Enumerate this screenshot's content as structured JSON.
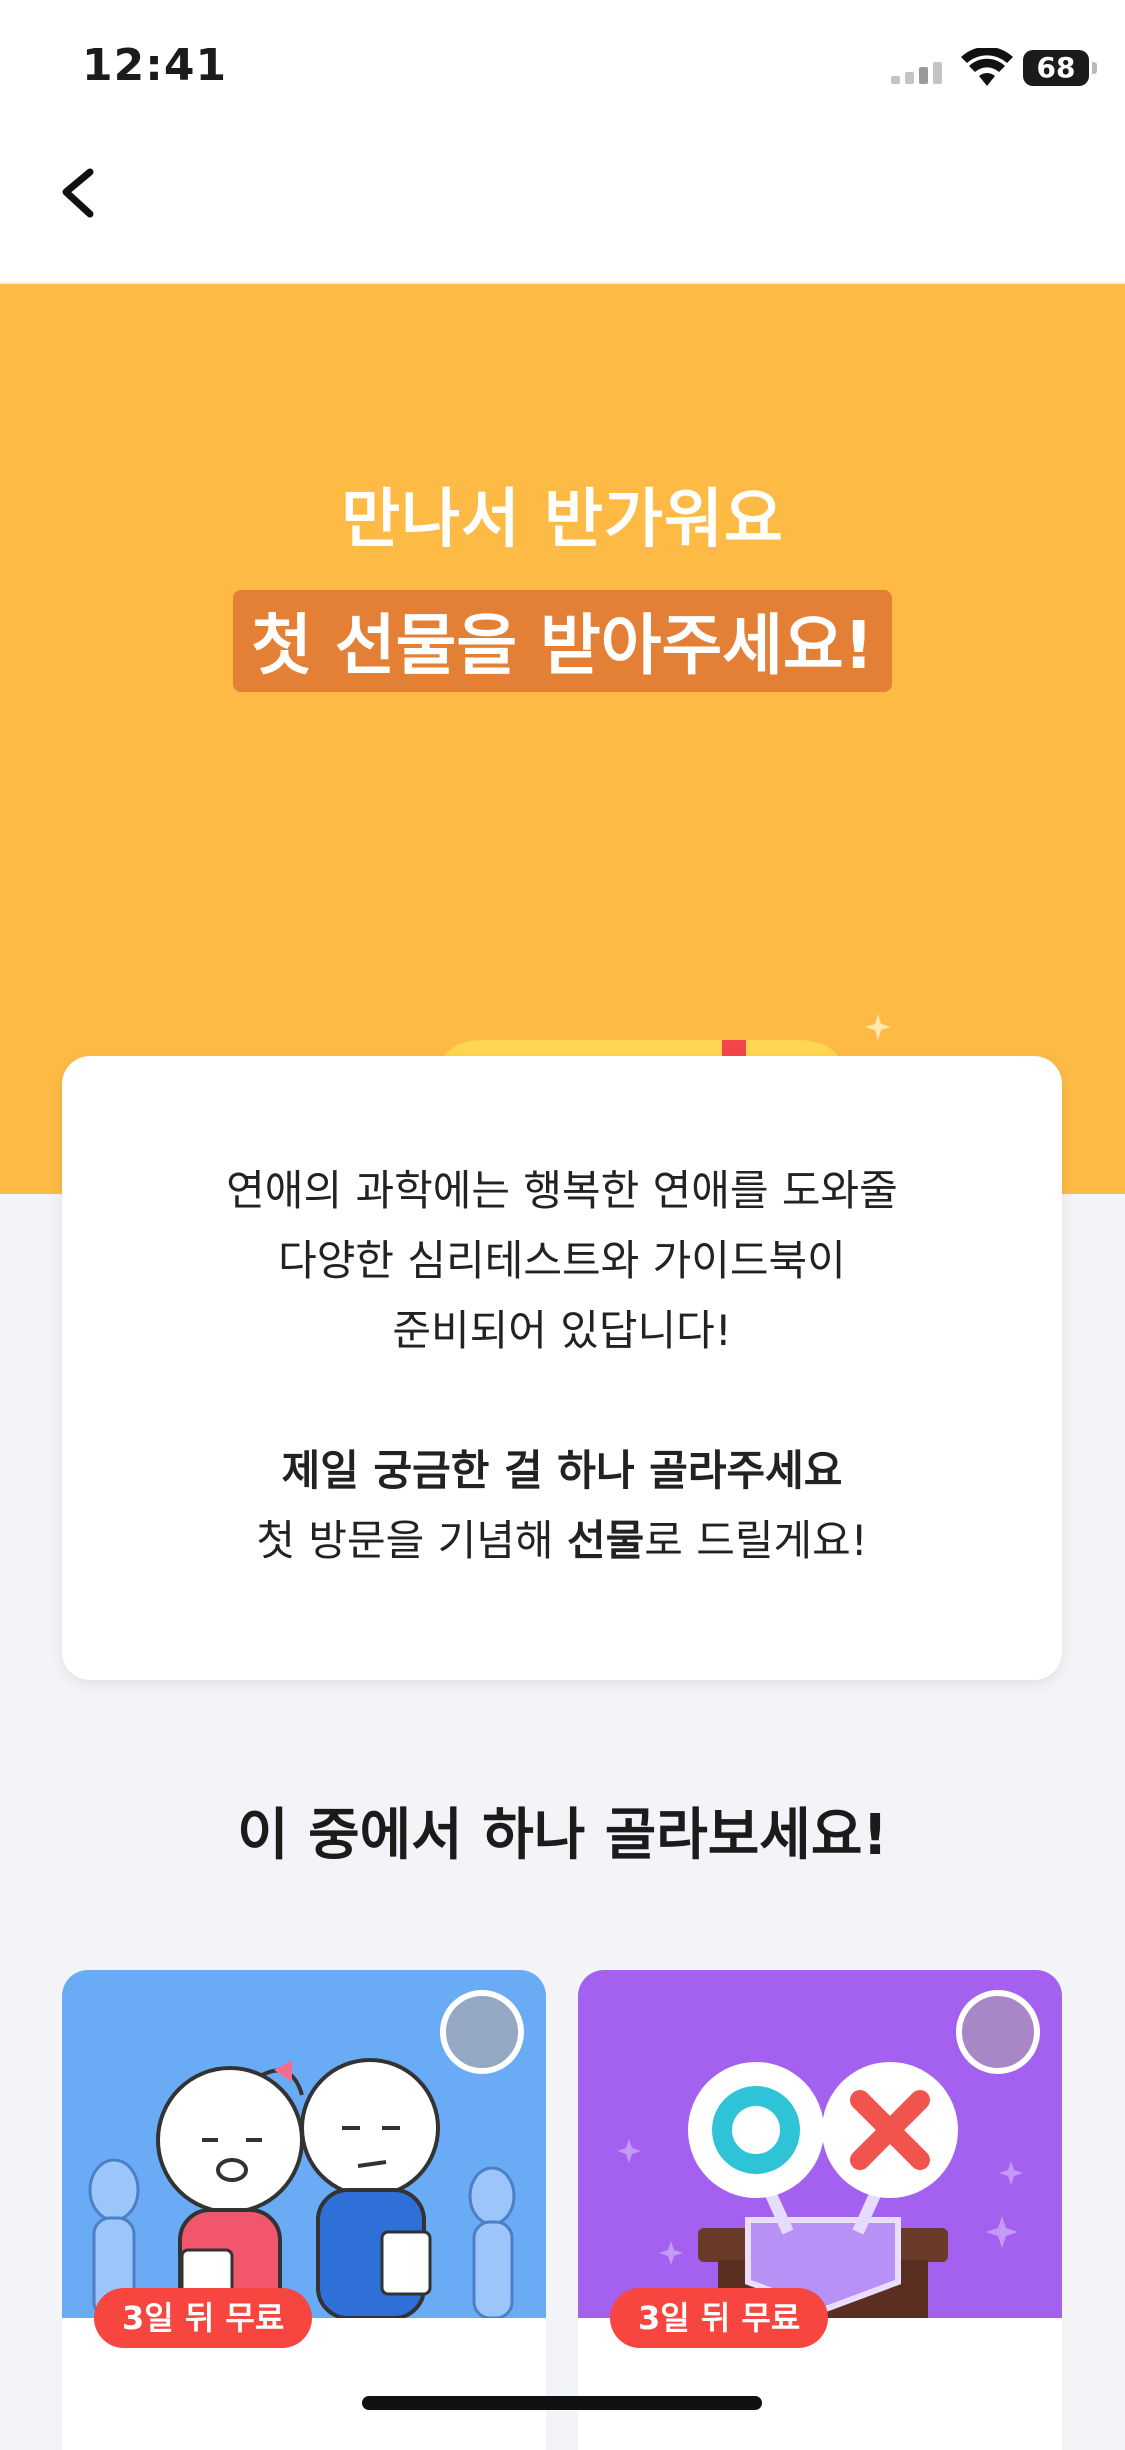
{
  "status": {
    "time": "12:41",
    "battery": "68"
  },
  "hero": {
    "line1": "만나서 반가워요",
    "line2": "첫 선물을 받아주세요!"
  },
  "card": {
    "intro_lines": [
      "연애의 과학에는 행복한 연애를 도와줄",
      "다양한 심리테스트와 가이드북이",
      "준비되어 있답니다!"
    ],
    "choose_bold": "제일 궁금한 걸 하나 골라주세요",
    "gift_prefix": "첫 방문을 기념해 ",
    "gift_bold": "선물",
    "gift_suffix": "로 드릴게요!"
  },
  "section_title": "이 중에서 하나 골라보세요!",
  "options": [
    {
      "badge": "3일 뒤 무료",
      "color": "#6aabf6"
    },
    {
      "badge": "3일 뒤 무료",
      "color": "#a461ef"
    }
  ],
  "colors": {
    "hero_bg": "#fdbb45",
    "highlight": "#e47f36",
    "badge": "#f7463f"
  }
}
